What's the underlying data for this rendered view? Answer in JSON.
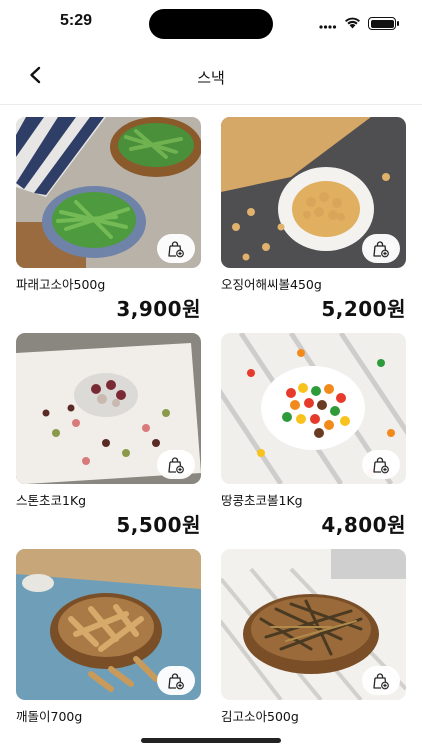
{
  "status_bar": {
    "time": "5:29"
  },
  "nav": {
    "title": "스낵"
  },
  "products": [
    {
      "name": "파래고소아500g",
      "price": "3,900원"
    },
    {
      "name": "오징어해씨볼450g",
      "price": "5,200원"
    },
    {
      "name": "스톤초코1Kg",
      "price": "5,500원"
    },
    {
      "name": "땅콩초코볼1Kg",
      "price": "4,800원"
    },
    {
      "name": "깨돌이700g",
      "price": ""
    },
    {
      "name": "김고소아500g",
      "price": ""
    }
  ],
  "icons": {
    "back": "chevron-left-icon",
    "cart": "shopping-bag-plus-icon"
  }
}
